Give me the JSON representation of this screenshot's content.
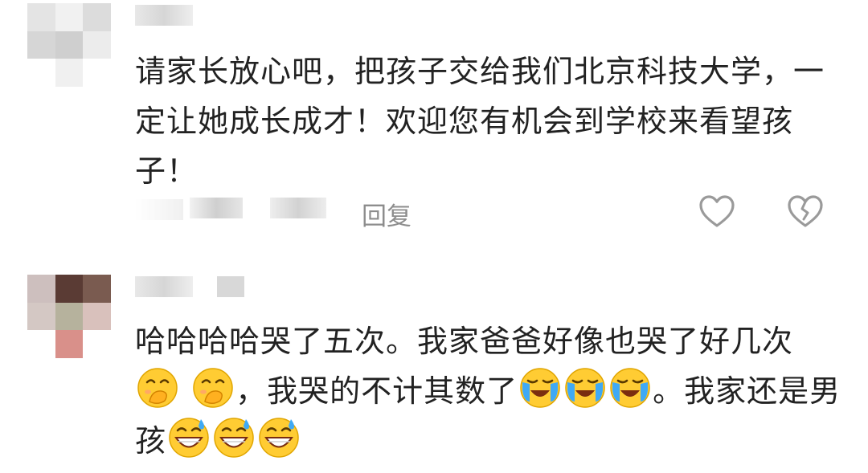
{
  "comments": [
    {
      "text": "请家长放心吧，把孩子交给我们北京科技大学，一定让她成长成才！欢迎您有机会到学校来看望孩子！",
      "reply_label": "回复"
    },
    {
      "text_part1": "哈哈哈哈哭了五次。我家爸爸好像也哭了好几次",
      "text_part2": "，我哭的不计其数了",
      "text_part3": "。我家还是男孩",
      "emoji_groups": {
        "group1": [
          "face-with-hand-over-mouth-icon",
          "face-with-hand-over-mouth-icon"
        ],
        "group2": [
          "loudly-crying-face-icon",
          "loudly-crying-face-icon",
          "loudly-crying-face-icon"
        ],
        "group3": [
          "grinning-face-with-sweat-icon",
          "grinning-face-with-sweat-icon",
          "grinning-face-with-sweat-icon"
        ]
      }
    }
  ],
  "colors": {
    "text": "#222222",
    "meta": "#8d8d8d",
    "icon": "#9a9a9a",
    "blur": "#d9d9d9"
  }
}
